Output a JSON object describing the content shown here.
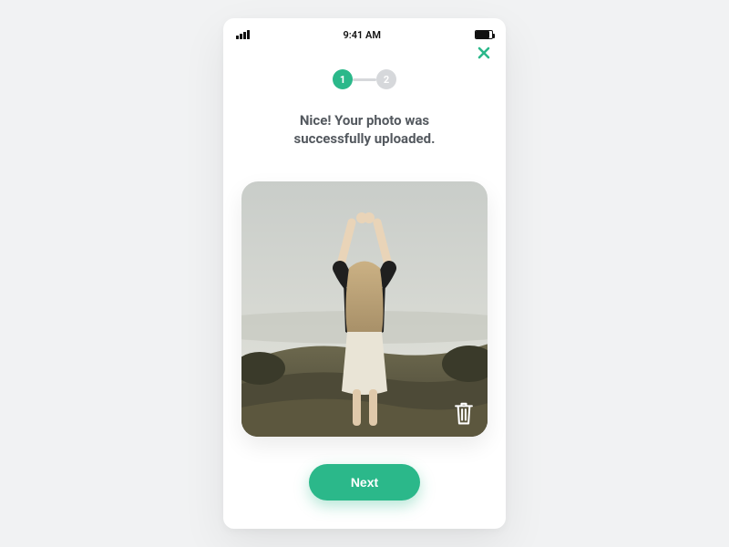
{
  "status_bar": {
    "time": "9:41 AM"
  },
  "stepper": {
    "steps": [
      "1",
      "2"
    ],
    "active_index": 0
  },
  "message": {
    "line1": "Nice! Your photo was",
    "line2": "successfully uploaded."
  },
  "actions": {
    "next": "Next"
  },
  "colors": {
    "accent": "#2bb88a",
    "muted": "#d6d8db",
    "text": "#54595f"
  }
}
